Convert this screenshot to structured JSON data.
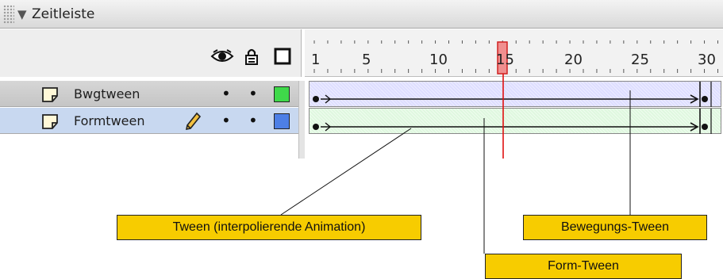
{
  "panel": {
    "title": "Zeitleiste"
  },
  "ruler": {
    "ticks": [
      "1",
      "5",
      "10",
      "15",
      "20",
      "25",
      "30"
    ],
    "current_frame": 15
  },
  "layers": [
    {
      "name": "Bwgtween",
      "visible_dot": "•",
      "lock_dot": "•",
      "color": "#3fd94a"
    },
    {
      "name": "Formtween",
      "visible_dot": "•",
      "lock_dot": "•",
      "color": "#4d7fe6"
    }
  ],
  "callouts": {
    "tween": "Tween (interpolierende Animation)",
    "motion": "Bewegungs-Tween",
    "shape": "Form-Tween"
  },
  "colors": {
    "motion_track": "#dedeff",
    "shape_track": "#dff8df",
    "playhead": "#e01010",
    "callout_bg": "#f7cc00"
  }
}
